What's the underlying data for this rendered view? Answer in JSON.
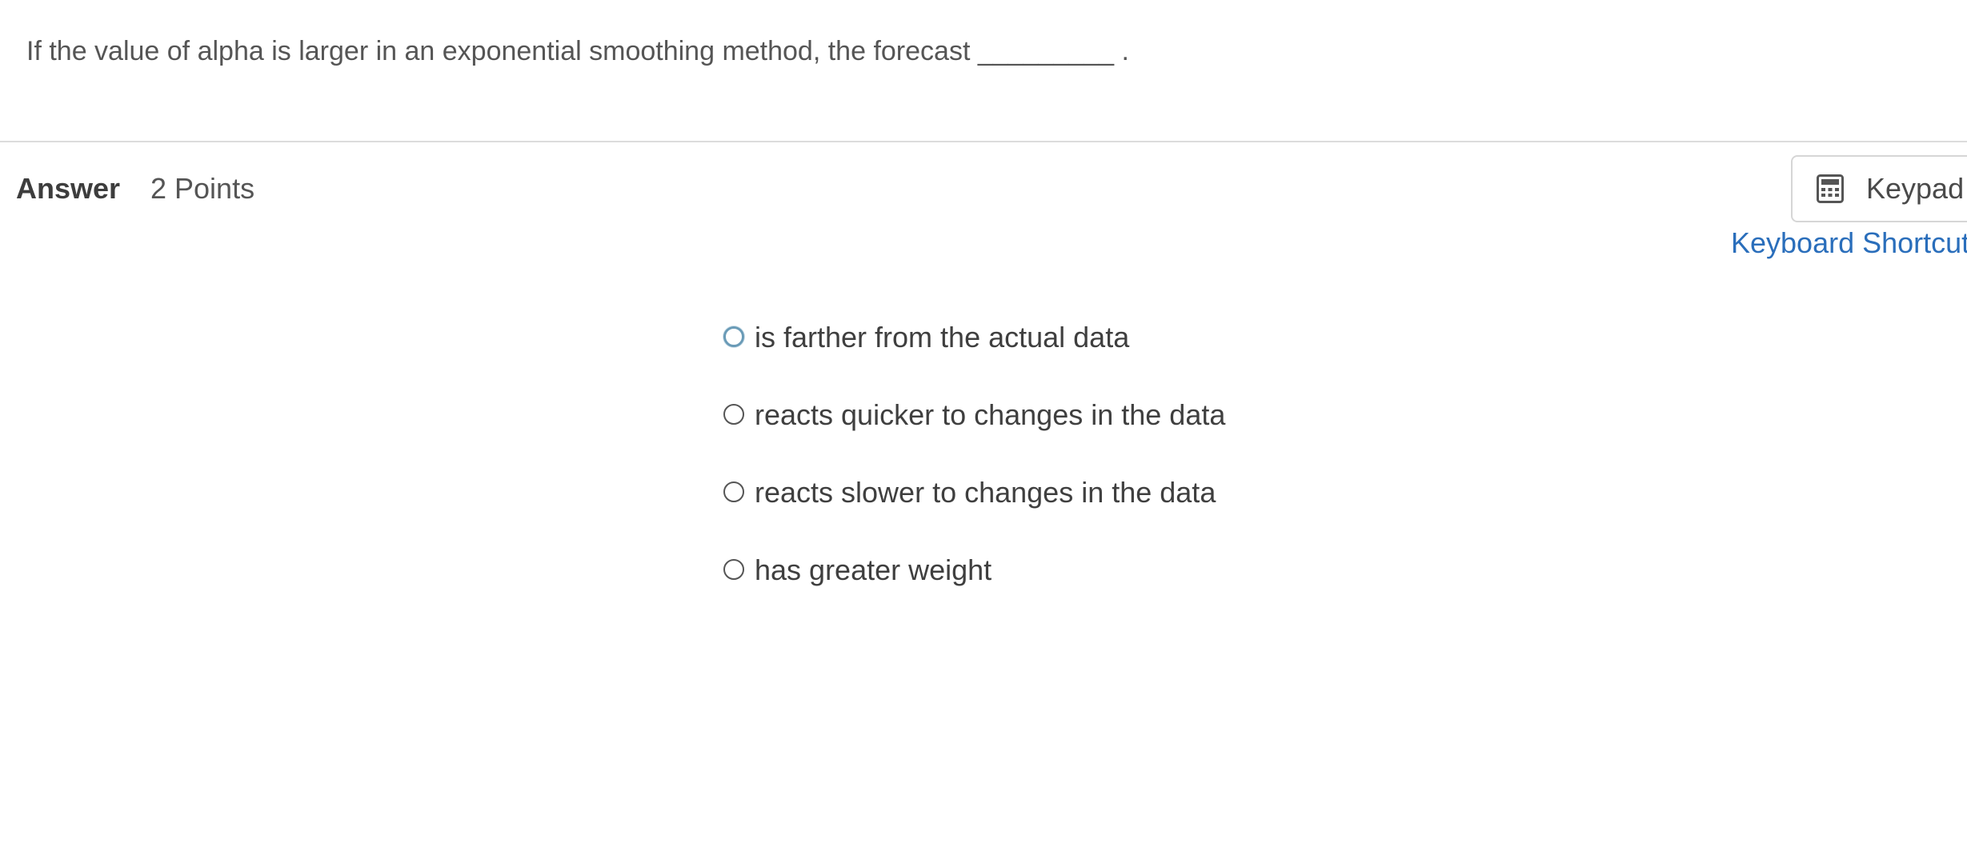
{
  "question": {
    "text": "If the value of alpha is larger in an exponential smoothing method, the forecast _________ ."
  },
  "answer": {
    "label": "Answer",
    "points": "2 Points"
  },
  "toolbar": {
    "keypad_label": "Keypad",
    "keypad_icon": "calculator-icon",
    "shortcuts_label": "Keyboard Shortcuts"
  },
  "options": [
    {
      "label": "is farther from the actual data",
      "selected": false,
      "focused": true
    },
    {
      "label": "reacts quicker to changes in the data",
      "selected": false,
      "focused": false
    },
    {
      "label": "reacts slower to changes in the data",
      "selected": false,
      "focused": false
    },
    {
      "label": "has greater weight",
      "selected": false,
      "focused": false
    }
  ],
  "colors": {
    "link": "#2a6ebb",
    "focus_ring": "#6a9bb7",
    "divider": "#dcdcdc"
  }
}
